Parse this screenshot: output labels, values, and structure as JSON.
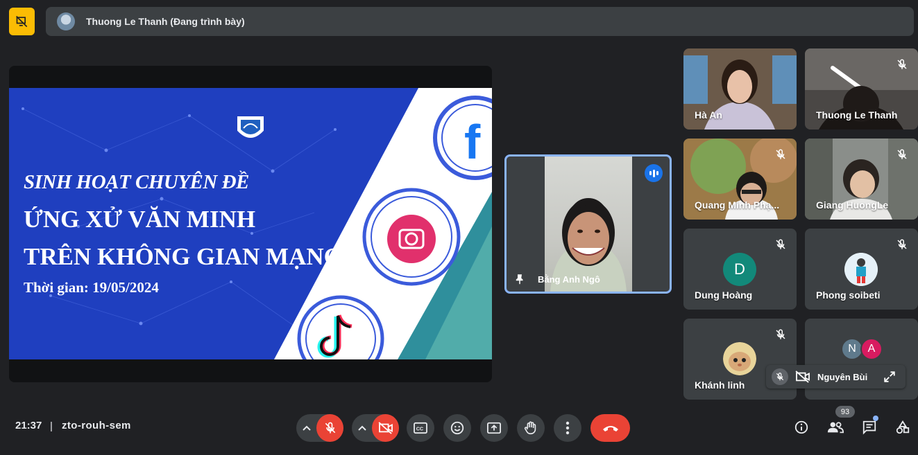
{
  "presenter": {
    "name": "Thuong Le Thanh (Đang trình bày)"
  },
  "slide": {
    "line1": "SINH HOẠT CHUYÊN ĐỀ",
    "line2": "ỨNG XỬ VĂN MINH",
    "line3": "TRÊN KHÔNG GIAN MẠNG",
    "line4": "Thời gian: 19/05/2024",
    "social_icons": [
      "facebook-icon",
      "instagram-icon",
      "tiktok-icon"
    ]
  },
  "spotlight": {
    "name": "Bằng Anh Ngô",
    "pinned": true,
    "speaking": true
  },
  "participants": [
    {
      "name": "Hà An",
      "muted": false,
      "video": true
    },
    {
      "name": "Thuong Le Thanh",
      "muted": true,
      "video": true
    },
    {
      "name": "Quang Minh Phạ...",
      "muted": true,
      "video": true
    },
    {
      "name": "Giang HuongLe",
      "muted": true,
      "video": true
    },
    {
      "name": "Dung Hoàng",
      "muted": true,
      "video": false,
      "initial": "D",
      "color": "#12897a"
    },
    {
      "name": "Phong soibeti",
      "muted": true,
      "video": false
    },
    {
      "name": "Khánh linh",
      "muted": true,
      "video": false
    }
  ],
  "overflow": {
    "initials": [
      "N",
      "A"
    ],
    "colors": [
      "#5f7a8c",
      "#d81b60"
    ],
    "name": "Nguyên Bùi"
  },
  "meeting": {
    "time": "21:37",
    "separator": "|",
    "code": "zto-rouh-sem"
  },
  "people_count": "93",
  "colors": {
    "accent": "#8ab4f8",
    "danger": "#ea4335",
    "warning": "#fbbc04",
    "surface": "#3c4043",
    "background": "#202124"
  }
}
